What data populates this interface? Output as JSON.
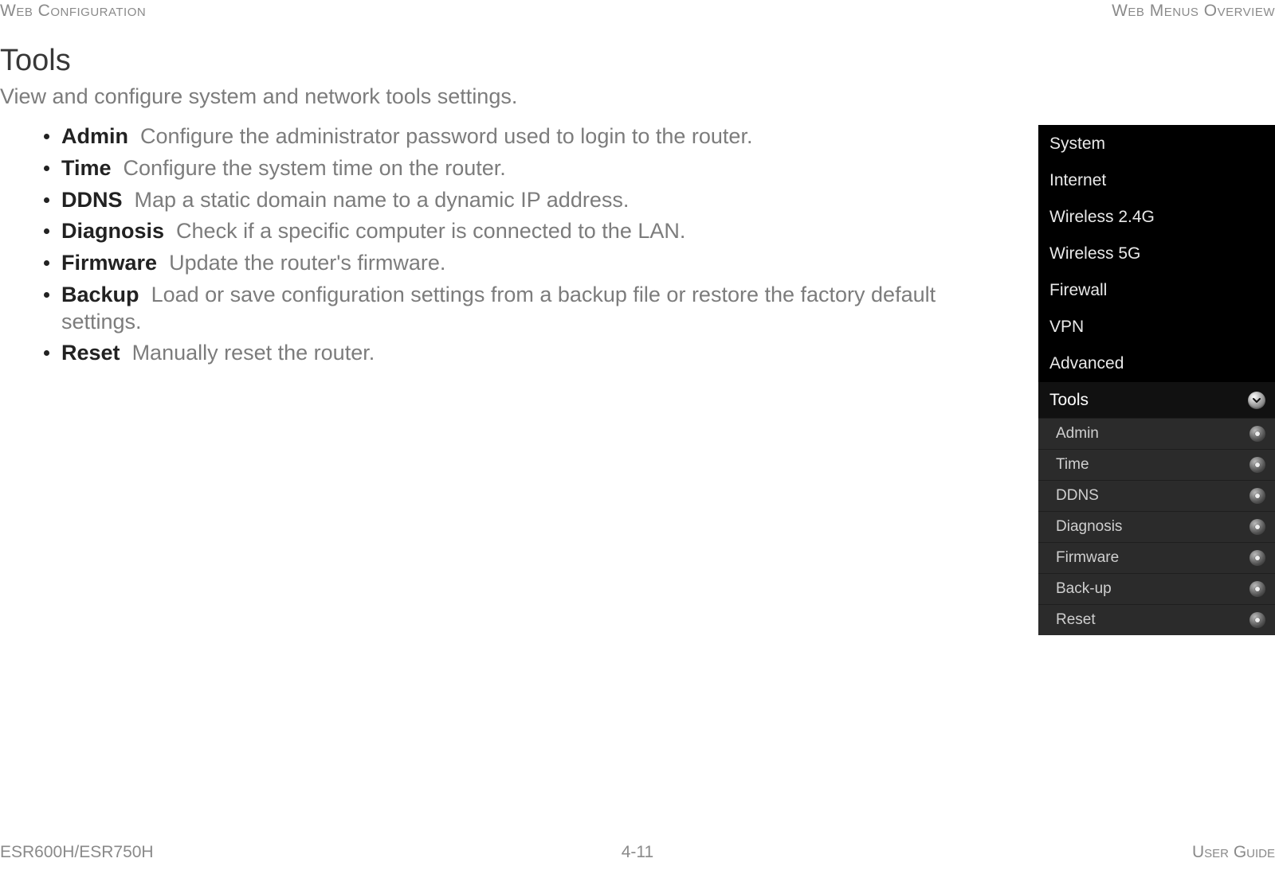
{
  "header": {
    "left": "Web Configuration",
    "right": "Web Menus Overview"
  },
  "footer": {
    "left": "ESR600H/ESR750H",
    "center": "4-11",
    "right": "User Guide"
  },
  "section": {
    "title": "Tools",
    "subtitle": "View and configure system and network tools settings."
  },
  "items": [
    {
      "term": "Admin",
      "desc": "Configure the administrator password used to login to the router."
    },
    {
      "term": "Time",
      "desc": "Configure the system time on the router."
    },
    {
      "term": "DDNS",
      "desc": "Map a static domain name to a dynamic IP address."
    },
    {
      "term": "Diagnosis",
      "desc": "Check if a specific computer is connected to the LAN."
    },
    {
      "term": "Firmware",
      "desc": "Update the router's firmware."
    },
    {
      "term": "Backup",
      "desc": "Load or save configuration settings from a backup file or restore the factory default settings."
    },
    {
      "term": "Reset",
      "desc": "Manually reset the router."
    }
  ],
  "menu": {
    "main": [
      {
        "label": "System"
      },
      {
        "label": "Internet"
      },
      {
        "label": "Wireless 2.4G"
      },
      {
        "label": "Wireless 5G"
      },
      {
        "label": "Firewall"
      },
      {
        "label": "VPN"
      },
      {
        "label": "Advanced"
      },
      {
        "label": "Tools",
        "expanded": true
      }
    ],
    "sub": [
      {
        "label": "Admin"
      },
      {
        "label": "Time"
      },
      {
        "label": "DDNS"
      },
      {
        "label": "Diagnosis"
      },
      {
        "label": "Firmware"
      },
      {
        "label": "Back-up"
      },
      {
        "label": "Reset"
      }
    ]
  }
}
